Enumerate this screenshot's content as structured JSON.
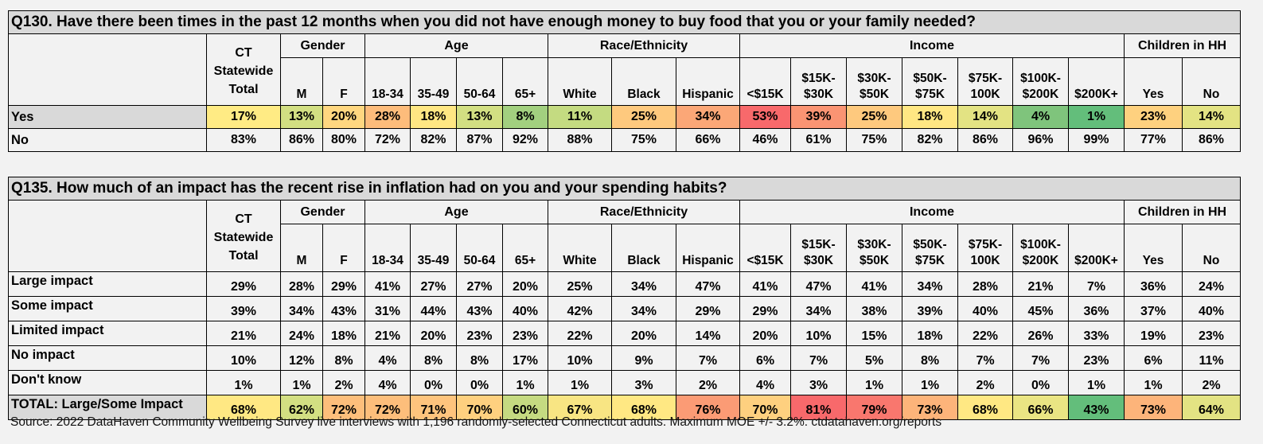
{
  "columns": {
    "total_header": "CT\nStatewide\nTotal",
    "groups": [
      {
        "label": "Gender",
        "span": 2
      },
      {
        "label": "Age",
        "span": 4
      },
      {
        "label": "Race/Ethnicity",
        "span": 3
      },
      {
        "label": "Income",
        "span": 7
      },
      {
        "label": "Children in HH",
        "span": 2
      }
    ],
    "subheaders": [
      "M",
      "F",
      "18-34",
      "35-49",
      "50-64",
      "65+",
      "White",
      "Black",
      "Hispanic",
      "<$15K",
      "$15K-\n$30K",
      "$30K-\n$50K",
      "$50K-\n$75K",
      "$75K-\n100K",
      "$100K-\n$200K",
      "$200K+",
      "Yes",
      "No"
    ]
  },
  "q130": {
    "title": "Q130. Have there been times in the past 12 months when you did not have enough money to buy food that you or your family needed?",
    "rows": [
      {
        "label": "Yes",
        "highlight": true,
        "values": [
          "17%",
          "13%",
          "20%",
          "28%",
          "18%",
          "13%",
          "8%",
          "11%",
          "25%",
          "34%",
          "53%",
          "39%",
          "25%",
          "18%",
          "14%",
          "4%",
          "1%",
          "23%",
          "14%"
        ],
        "colors": [
          "#ffeb84",
          "#d2df82",
          "#ffd780",
          "#fdbc7b",
          "#ffe783",
          "#d2df82",
          "#a2d07f",
          "#c4db81",
          "#fec97e",
          "#fba777",
          "#f8696b",
          "#fa9473",
          "#fec97e",
          "#ffe783",
          "#e3e383",
          "#7fc47c",
          "#63be7b",
          "#fed17f",
          "#e3e383"
        ]
      },
      {
        "label": "No",
        "highlight": false,
        "values": [
          "83%",
          "86%",
          "80%",
          "72%",
          "82%",
          "87%",
          "92%",
          "88%",
          "75%",
          "66%",
          "46%",
          "61%",
          "75%",
          "82%",
          "86%",
          "96%",
          "99%",
          "77%",
          "86%"
        ],
        "colors": []
      }
    ]
  },
  "q135": {
    "title": "Q135. How much of an impact has the recent rise in inflation had on you and your spending habits?",
    "rows": [
      {
        "label": "Large impact",
        "highlight": false,
        "values": [
          "29%",
          "28%",
          "29%",
          "41%",
          "27%",
          "27%",
          "20%",
          "25%",
          "34%",
          "47%",
          "41%",
          "47%",
          "41%",
          "34%",
          "28%",
          "21%",
          "7%",
          "36%",
          "24%"
        ],
        "colors": []
      },
      {
        "label": "Some impact",
        "highlight": false,
        "values": [
          "39%",
          "34%",
          "43%",
          "31%",
          "44%",
          "43%",
          "40%",
          "42%",
          "34%",
          "29%",
          "29%",
          "34%",
          "38%",
          "39%",
          "40%",
          "45%",
          "36%",
          "37%",
          "40%"
        ],
        "colors": []
      },
      {
        "label": "Limited impact",
        "highlight": false,
        "values": [
          "21%",
          "24%",
          "18%",
          "21%",
          "20%",
          "23%",
          "23%",
          "22%",
          "20%",
          "14%",
          "20%",
          "10%",
          "15%",
          "18%",
          "22%",
          "26%",
          "33%",
          "19%",
          "23%"
        ],
        "colors": []
      },
      {
        "label": "No impact",
        "highlight": false,
        "values": [
          "10%",
          "12%",
          "8%",
          "4%",
          "8%",
          "8%",
          "17%",
          "10%",
          "9%",
          "7%",
          "6%",
          "7%",
          "5%",
          "8%",
          "7%",
          "7%",
          "23%",
          "6%",
          "11%"
        ],
        "colors": []
      },
      {
        "label": "Don't know",
        "highlight": false,
        "values": [
          "1%",
          "1%",
          "2%",
          "4%",
          "0%",
          "0%",
          "1%",
          "1%",
          "3%",
          "2%",
          "4%",
          "3%",
          "1%",
          "1%",
          "2%",
          "0%",
          "1%",
          "1%",
          "2%"
        ],
        "colors": []
      },
      {
        "label": "TOTAL: Large/Some Impact",
        "highlight": true,
        "values": [
          "68%",
          "62%",
          "72%",
          "72%",
          "71%",
          "70%",
          "60%",
          "67%",
          "68%",
          "76%",
          "70%",
          "81%",
          "79%",
          "73%",
          "68%",
          "66%",
          "43%",
          "73%",
          "64%"
        ],
        "colors": [
          "#ffe883",
          "#d3df82",
          "#fdbe7b",
          "#fdbe7b",
          "#fec47d",
          "#fed07f",
          "#c5da81",
          "#f8e583",
          "#ffe883",
          "#fb9b75",
          "#fed07f",
          "#f8696b",
          "#f9776e",
          "#fdb47a",
          "#ffe883",
          "#eae583",
          "#63be7b",
          "#fdb47a",
          "#e3e383"
        ]
      }
    ]
  },
  "source": "Source: 2022 DataHaven Community Wellbeing Survey live interviews with 1,196 randomly-selected Connecticut adults. Maximum MOE +/- 3.2%. ctdatahaven.org/reports"
}
